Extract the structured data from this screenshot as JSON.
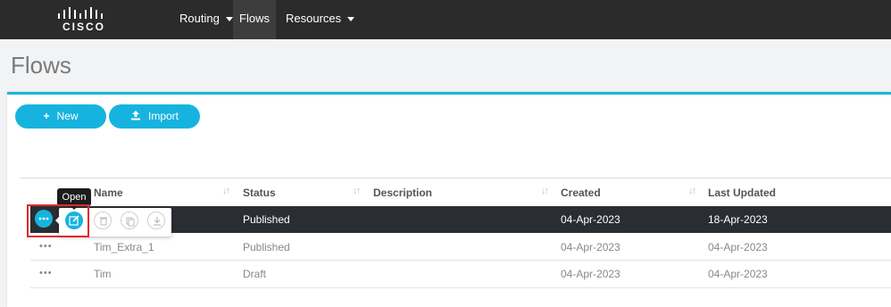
{
  "brand": {
    "logo_text": "CISCO"
  },
  "nav": {
    "routing": "Routing",
    "flows": "Flows",
    "resources": "Resources"
  },
  "page": {
    "title": "Flows"
  },
  "toolbar": {
    "new_label": "New",
    "import_label": "Import"
  },
  "table": {
    "headers": {
      "name": "Name",
      "status": "Status",
      "description": "Description",
      "created": "Created",
      "last_updated": "Last Updated"
    },
    "rows": [
      {
        "name": "",
        "status": "Published",
        "description": "",
        "created": "04-Apr-2023",
        "last_updated": "18-Apr-2023"
      },
      {
        "name": "Tim_Extra_1",
        "status": "Published",
        "description": "",
        "created": "04-Apr-2023",
        "last_updated": "04-Apr-2023"
      },
      {
        "name": "Tim",
        "status": "Draft",
        "description": "",
        "created": "04-Apr-2023",
        "last_updated": "04-Apr-2023"
      }
    ]
  },
  "actions": {
    "tooltip": "Open",
    "more_dots": "•••"
  },
  "icons": [
    "cisco-logo",
    "plus-icon",
    "upload-icon",
    "sort-icon",
    "more-icon",
    "edit-icon",
    "trash-icon",
    "copy-icon",
    "download-icon"
  ],
  "colors": {
    "accent": "#17b3df",
    "topbar": "#2b2b2b",
    "selected_row": "#2a2e33",
    "highlight": "#e02b2b"
  }
}
